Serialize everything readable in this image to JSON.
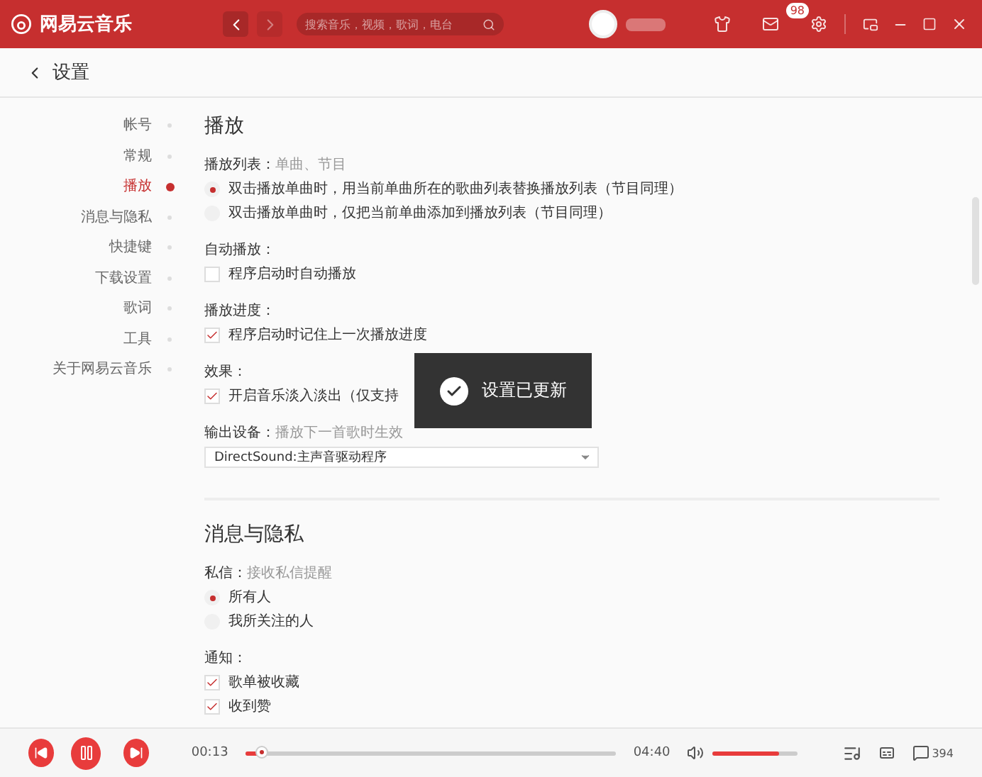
{
  "app": {
    "name": "网易云音乐"
  },
  "search": {
    "placeholder": "搜索音乐，视频，歌词，电台"
  },
  "mail": {
    "badge": "98"
  },
  "page": {
    "title": "设置"
  },
  "sidebar": {
    "items": [
      {
        "label": "帐号",
        "selected": false
      },
      {
        "label": "常规",
        "selected": false
      },
      {
        "label": "播放",
        "selected": true
      },
      {
        "label": "消息与隐私",
        "selected": false
      },
      {
        "label": "快捷键",
        "selected": false
      },
      {
        "label": "下载设置",
        "selected": false
      },
      {
        "label": "歌词",
        "selected": false
      },
      {
        "label": "工具",
        "selected": false
      },
      {
        "label": "关于网易云音乐",
        "selected": false
      }
    ]
  },
  "sections": [
    {
      "title": "播放",
      "groups": [
        {
          "label": "播放列表：",
          "hint": "单曲、节目",
          "options": [
            {
              "kind": "radio",
              "label": "双击播放单曲时，用当前单曲所在的歌曲列表替换播放列表（节目同理）",
              "selected": true
            },
            {
              "kind": "radio",
              "label": "双击播放单曲时，仅把当前单曲添加到播放列表（节目同理）",
              "selected": false
            }
          ]
        },
        {
          "label": "自动播放：",
          "options": [
            {
              "kind": "checkbox",
              "label": "程序启动时自动播放",
              "checked": false
            }
          ]
        },
        {
          "label": "播放进度：",
          "options": [
            {
              "kind": "checkbox",
              "label": "程序启动时记住上一次播放进度",
              "checked": true
            }
          ]
        },
        {
          "label": "效果：",
          "options": [
            {
              "kind": "checkbox",
              "label": "开启音乐淡入淡出（仅支持",
              "checked": true
            }
          ]
        },
        {
          "label": "输出设备：",
          "hint": "播放下一首歌时生效",
          "options": [
            {
              "kind": "select",
              "value": "DirectSound:主声音驱动程序"
            }
          ]
        }
      ]
    },
    {
      "title": "消息与隐私",
      "groups": [
        {
          "label": "私信：",
          "hint": "接收私信提醒",
          "options": [
            {
              "kind": "radio",
              "label": "所有人",
              "selected": true
            },
            {
              "kind": "radio",
              "label": "我所关注的人",
              "selected": false
            }
          ]
        },
        {
          "label": "通知：",
          "options": [
            {
              "kind": "checkbox",
              "label": "歌单被收藏",
              "checked": true
            },
            {
              "kind": "checkbox",
              "label": "收到赞",
              "checked": true
            }
          ]
        }
      ]
    }
  ],
  "toast": {
    "text": "设置已更新"
  },
  "player": {
    "playing": true,
    "elapsed": "00:13",
    "duration": "04:40",
    "progress": {
      "level": 0.045
    },
    "volume": {
      "level": 0.78
    },
    "comment_count": "394"
  }
}
